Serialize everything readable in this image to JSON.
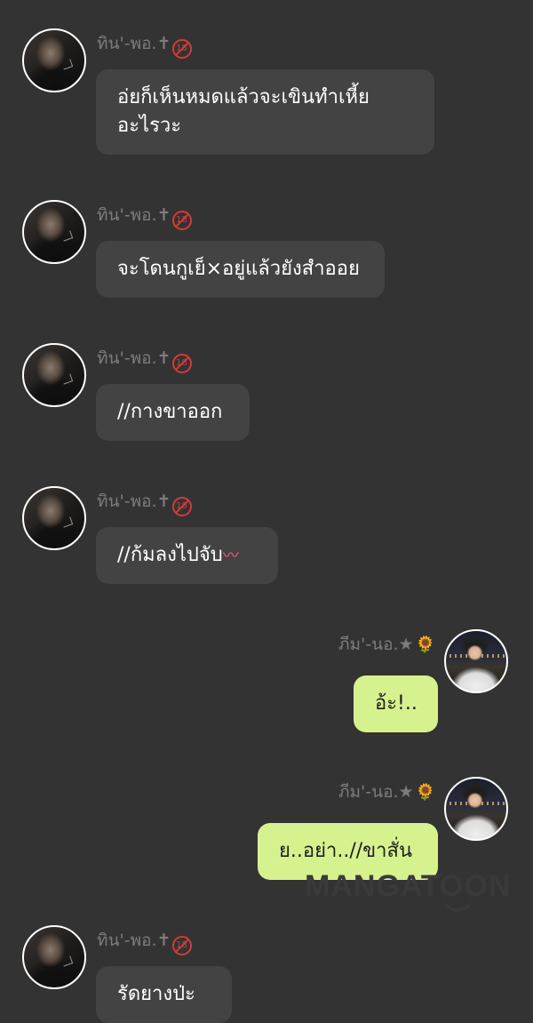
{
  "left_user": {
    "name": "ทิน'-พอ.",
    "cross": "✝",
    "badge": "18",
    "avatar_icon": "avatar-dark-icon"
  },
  "right_user": {
    "name": "ภีม'-นอ.",
    "star": "★",
    "sun": "🌻",
    "avatar_icon": "avatar-light-icon"
  },
  "messages": [
    {
      "side": "left",
      "text": "อ่ยก็เห็นหมดแล้วจะเขินทำเหี้ย อะไรวะ"
    },
    {
      "side": "left",
      "text": "จะโดนกูเย็×อยู่แล้วยังสำออย"
    },
    {
      "side": "left",
      "text": "//กางขาออก"
    },
    {
      "side": "left",
      "text": "//ก้มลงไปจับ",
      "emoji": "〰"
    },
    {
      "side": "right",
      "text": "อ้ะ!.."
    },
    {
      "side": "right",
      "text": "ย..อย่า..//ขาสั่น"
    },
    {
      "side": "left",
      "text": "รัดยางป่ะ"
    }
  ],
  "watermark": "MANGATOON",
  "colors": {
    "background": "#333333",
    "left_bubble": "#434343",
    "right_bubble": "#d6f28e",
    "name_text": "#7c7c7c",
    "badge": "#d23b3b"
  }
}
